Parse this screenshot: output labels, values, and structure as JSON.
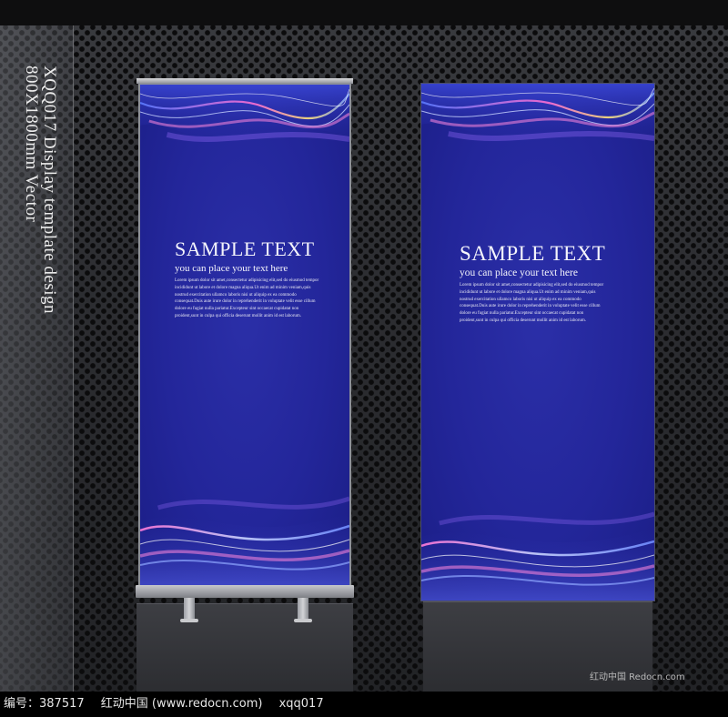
{
  "side_caption": {
    "line1": "XQQ017 Display template design",
    "line2": "800X1800mm Vector"
  },
  "banner_left": {
    "title": "SAMPLE TEXT",
    "subtitle": "you can place your text here",
    "body_lines": [
      "Lorem ipsum dolor sit amet,consectetur adipisicing elit,sed do eiusmod tempor",
      "incididunt ut labore et dolore magna aliqua.Ut enim ad minim veniam,quis",
      "nostrud exercitation ullamco laboris nisi ut aliquip ex ea commodo",
      "consequat.Duis aute irure dolor in reprehenderit in voluptate velit esse cillum",
      "dolore eu fugiat nulla pariatur.Excepteur sint occaecat cupidatat non",
      "proident,sunt in culpa qui officia deserunt mollit anim id est laborum."
    ]
  },
  "banner_right": {
    "title": "SAMPLE TEXT",
    "subtitle": "you can place your text here",
    "body_lines": [
      "Lorem ipsum dolor sit amet,consectetur adipisicing elit,sed do eiusmod tempor",
      "incididunt ut labore et dolore magna aliqua.Ut enim ad minim veniam,quis",
      "nostrud exercitation ullamco laboris nisi ut aliquip ex ea commodo",
      "consequat.Duis aute irure dolor in reprehenderit in voluptate velit esse cillum",
      "dolore eu fugiat nulla pariatur.Excepteur sint occaecat cupidatat non",
      "proident,sunt in culpa qui officia deserunt mollit anim id est laborum."
    ]
  },
  "watermark": "红动中国 Redocn.com",
  "footer": {
    "id_label": "编号：387517",
    "site": "红动中国 (www.redocn.com)",
    "code": "xqq017"
  },
  "colors": {
    "banner_blue": "#23269a",
    "background": "#2b2c30"
  }
}
